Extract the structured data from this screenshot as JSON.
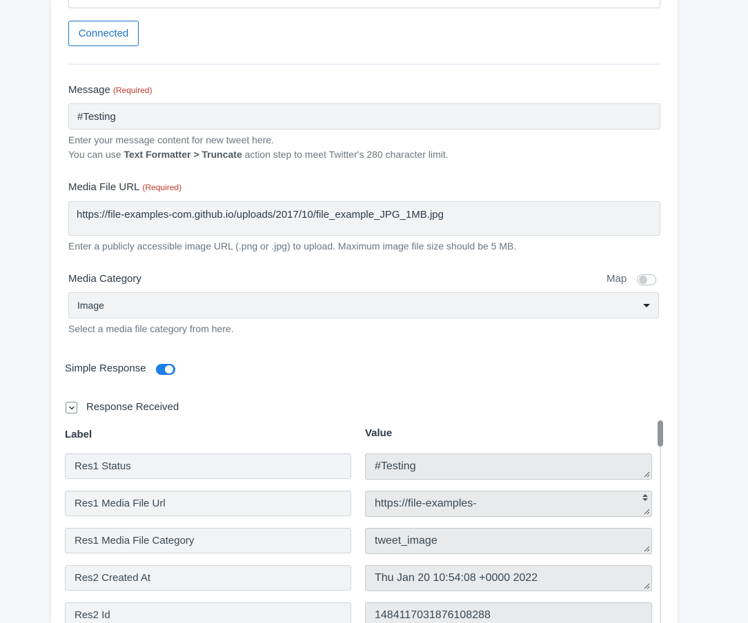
{
  "connection": {
    "button_label": "Connected"
  },
  "message": {
    "label": "Message",
    "required": "(Required)",
    "value": "#Testing",
    "help_line1": "Enter your message content for new tweet here.",
    "help_line2_prefix": "You can use ",
    "help_line2_bold": "Text Formatter > Truncate",
    "help_line2_suffix": " action step to meet Twitter's 280 character limit."
  },
  "media_url": {
    "label": "Media File URL",
    "required": "(Required)",
    "value": "https://file-examples-com.github.io/uploads/2017/10/file_example_JPG_1MB.jpg",
    "help": "Enter a publicly accessible image URL (.png or .jpg) to upload. Maximum image file size should be 5 MB."
  },
  "media_category": {
    "label": "Media Category",
    "map_label": "Map",
    "selected": "Image",
    "help": "Select a media file category from here."
  },
  "simple_response": {
    "label": "Simple Response",
    "enabled": true
  },
  "response": {
    "title": "Response Received",
    "label_header": "Label",
    "value_header": "Value",
    "rows": [
      {
        "label": "Res1 Status",
        "value": "#Testing"
      },
      {
        "label": "Res1 Media File Url",
        "value": "https://file-examples-"
      },
      {
        "label": "Res1 Media File Category",
        "value": "tweet_image"
      },
      {
        "label": "Res2 Created At",
        "value": "Thu Jan 20 10:54:08 +0000 2022"
      },
      {
        "label": "Res2 Id",
        "value": "1484117031876108288"
      }
    ]
  },
  "colors": {
    "accent": "#1a73c9",
    "required": "#c0392b",
    "toggle_on": "#1a7fe8"
  }
}
